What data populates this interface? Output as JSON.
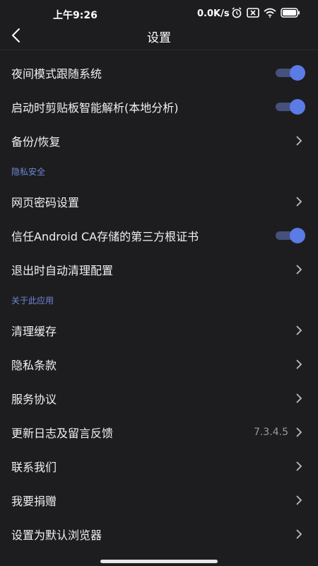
{
  "status_bar": {
    "time": "上午9:26",
    "network_speed": "0.0K/s",
    "icons": [
      "alarm-icon",
      "sim-off-icon",
      "wifi-icon",
      "battery-icon"
    ]
  },
  "header": {
    "title": "设置",
    "back_icon": "back-arrow-icon"
  },
  "settings": {
    "night_mode_follow_system": {
      "label": "夜间模式跟随系统",
      "enabled": true
    },
    "clipboard_parse": {
      "label": "启动时剪贴板智能解析(本地分析)",
      "enabled": true
    },
    "backup_restore": {
      "label": "备份/恢复"
    },
    "privacy_section": "隐私安全",
    "web_password": {
      "label": "网页密码设置"
    },
    "trust_ca": {
      "label": "信任Android CA存储的第三方根证书",
      "enabled": true
    },
    "auto_clean_on_exit": {
      "label": "退出时自动清理配置"
    },
    "about_section": "关于此应用",
    "clear_cache": {
      "label": "清理缓存"
    },
    "privacy_policy": {
      "label": "隐私条款"
    },
    "service_agreement": {
      "label": "服务协议"
    },
    "changelog_feedback": {
      "label": "更新日志及留言反馈",
      "version": "7.3.4.5"
    },
    "contact_us": {
      "label": "联系我们"
    },
    "donate": {
      "label": "我要捐赠"
    },
    "set_default_browser": {
      "label": "设置为默认浏览器"
    }
  },
  "colors": {
    "background": "#1d1d1f",
    "accent": "#5b7be6",
    "section_text": "#6f86d9"
  }
}
